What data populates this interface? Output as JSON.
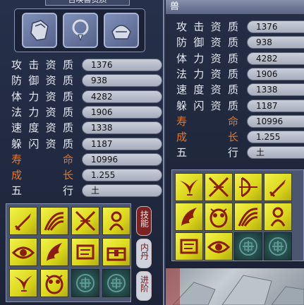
{
  "left": {
    "title": "召唤兽资质",
    "equipment": [
      {
        "icon": "armor-icon"
      },
      {
        "icon": "necklace-icon"
      },
      {
        "icon": "helmet-icon"
      }
    ],
    "stats": [
      {
        "label": "攻击资质",
        "value": "1376",
        "color": "white"
      },
      {
        "label": "防御资质",
        "value": "938",
        "color": "white"
      },
      {
        "label": "体力资质",
        "value": "4282",
        "color": "white"
      },
      {
        "label": "法力资质",
        "value": "1906",
        "color": "white"
      },
      {
        "label": "速度资质",
        "value": "1338",
        "color": "white"
      },
      {
        "label": "躲闪资质",
        "value": "1187",
        "color": "white"
      },
      {
        "label": "寿命",
        "value": "10996",
        "color": "orange"
      },
      {
        "label": "成长",
        "value": "1.255",
        "color": "orange"
      },
      {
        "label": "五行",
        "value": "土",
        "color": "white"
      }
    ],
    "skills": [
      "sword-skill-icon",
      "claw-skill-icon",
      "cross-blades-skill-icon",
      "figure-skill-icon",
      "eye-skill-icon",
      "wing-skill-icon",
      "scroll-skill-icon",
      "chest-skill-icon",
      "bird-skill-icon",
      "owl-skill-icon",
      "empty-slot",
      "empty-slot"
    ],
    "tabs": [
      {
        "label": "技能",
        "active": true
      },
      {
        "label": "内丹",
        "active": false
      },
      {
        "label": "进阶",
        "active": false
      }
    ]
  },
  "right": {
    "title": "兽",
    "stats": [
      {
        "label": "攻击资质",
        "value": "1376",
        "color": "white"
      },
      {
        "label": "防御资质",
        "value": "938",
        "color": "white"
      },
      {
        "label": "体力资质",
        "value": "4282",
        "color": "white"
      },
      {
        "label": "法力资质",
        "value": "1906",
        "color": "white"
      },
      {
        "label": "速度资质",
        "value": "1338",
        "color": "white"
      },
      {
        "label": "躲闪资质",
        "value": "1187",
        "color": "white"
      },
      {
        "label": "寿命",
        "value": "10996",
        "color": "orange"
      },
      {
        "label": "成长",
        "value": "1.255",
        "color": "orange"
      },
      {
        "label": "五行",
        "value": "土",
        "color": "white"
      }
    ],
    "skills": [
      "bird-skill-icon",
      "cross-blades-skill-icon",
      "bow-skill-icon",
      "sword-skill-icon",
      "wing-skill-icon",
      "owl-skill-icon",
      "claw-skill-icon",
      "figure-skill-icon",
      "scroll-skill-icon",
      "eye-skill-icon",
      "empty-slot",
      "empty-slot"
    ]
  },
  "colors": {
    "label_white": "#e6e9f2",
    "label_orange": "#e0792a",
    "skill_yellow": "#e6e22a",
    "skill_glyph": "#8a1c10",
    "tab_active": "#7c2222"
  }
}
